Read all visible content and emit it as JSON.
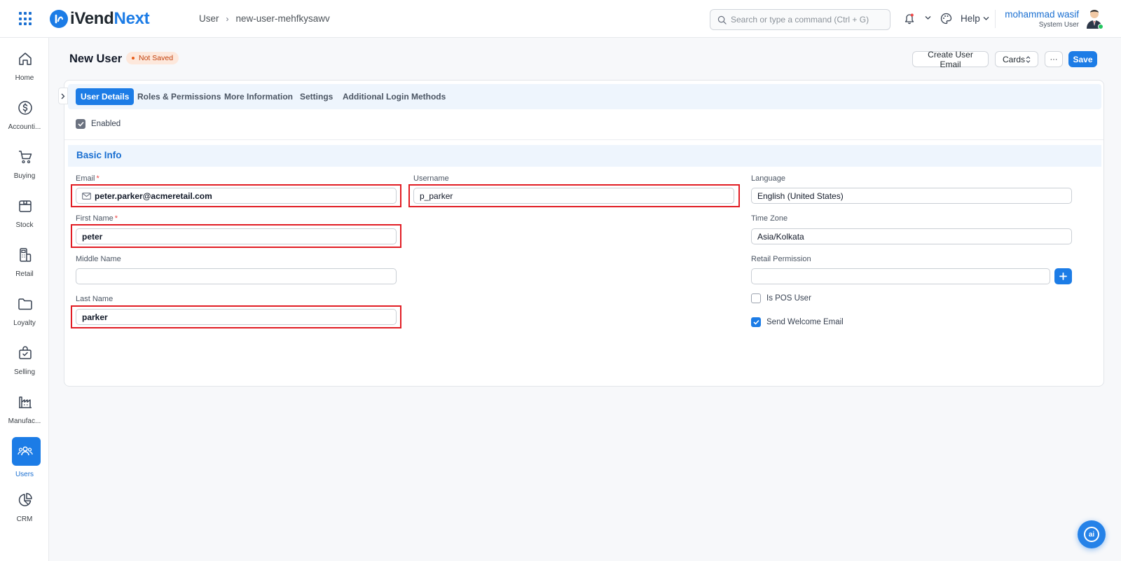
{
  "header": {
    "logo_prefix": "i",
    "logo_name_a": "Vend",
    "logo_name_b": "Next",
    "breadcrumb": [
      "User",
      "new-user-mehfkysawv"
    ],
    "search_placeholder": "Search or type a command (Ctrl + G)",
    "help_label": "Help",
    "user_name": "mohammad wasif",
    "user_role": "System User",
    "brand_color": "#1c7ce6"
  },
  "sidebar": {
    "items": [
      {
        "label": "Home",
        "icon": "home-icon"
      },
      {
        "label": "Accounti...",
        "icon": "dollar-circle-icon"
      },
      {
        "label": "Buying",
        "icon": "cart-icon"
      },
      {
        "label": "Stock",
        "icon": "box-icon"
      },
      {
        "label": "Retail",
        "icon": "pos-terminal-icon"
      },
      {
        "label": "Loyalty",
        "icon": "folder-icon"
      },
      {
        "label": "Selling",
        "icon": "shopping-bag-icon"
      },
      {
        "label": "Manufac...",
        "icon": "factory-icon"
      },
      {
        "label": "Users",
        "icon": "users-icon",
        "active": true
      },
      {
        "label": "CRM",
        "icon": "pie-chart-icon"
      }
    ]
  },
  "page": {
    "title": "New User",
    "status": "Not Saved",
    "actions": {
      "create_email": "Create User Email",
      "cards": "Cards",
      "more": "···",
      "save": "Save"
    }
  },
  "tabs": [
    "User Details",
    "Roles & Permissions",
    "More Information",
    "Settings",
    "Additional Login Methods"
  ],
  "form": {
    "enabled_label": "Enabled",
    "enabled": true,
    "section_title": "Basic Info",
    "email": {
      "label": "Email",
      "value": "peter.parker@acmeretail.com",
      "required": true
    },
    "username": {
      "label": "Username",
      "value": "p_parker"
    },
    "language": {
      "label": "Language",
      "value": "English (United States)"
    },
    "first_name": {
      "label": "First Name",
      "value": "peter",
      "required": true
    },
    "time_zone": {
      "label": "Time Zone",
      "value": "Asia/Kolkata"
    },
    "middle_name": {
      "label": "Middle Name",
      "value": ""
    },
    "retail_permission": {
      "label": "Retail Permission",
      "value": ""
    },
    "last_name": {
      "label": "Last Name",
      "value": "parker"
    },
    "is_pos_user": {
      "label": "Is POS User",
      "checked": false
    },
    "send_welcome_email": {
      "label": "Send Welcome Email",
      "checked": true
    }
  },
  "assistant": {
    "label": "ai"
  }
}
